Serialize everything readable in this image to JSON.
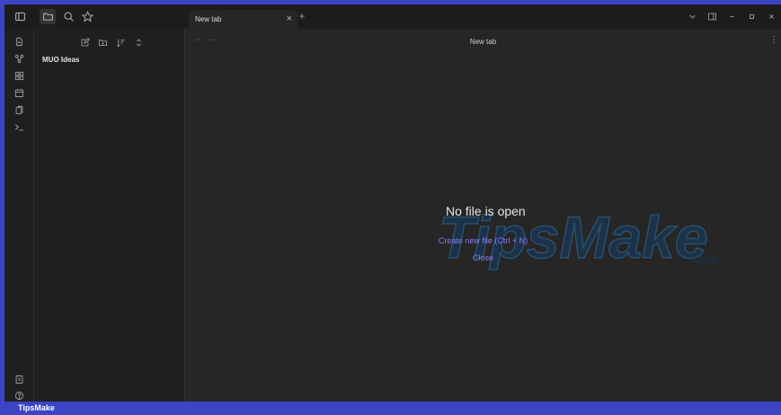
{
  "titlebar": {
    "icons": [
      "sidebar-toggle-icon",
      "folder-icon",
      "search-icon",
      "star-icon"
    ],
    "tab": {
      "title": "New tab",
      "close": "×"
    },
    "new_tab": "+",
    "window_controls": [
      "chevron-down-icon",
      "layout-icon",
      "minimize-icon",
      "maximize-icon",
      "close-icon"
    ]
  },
  "ribbon": {
    "top": [
      "open-quick-switcher-icon",
      "graph-view-icon",
      "canvas-icon",
      "daily-note-icon",
      "templates-icon",
      "command-palette-icon"
    ],
    "bottom": [
      "vault-switcher-icon",
      "help-icon"
    ]
  },
  "explorer": {
    "tools": [
      "new-note-icon",
      "new-folder-icon",
      "sort-icon",
      "collapse-icon"
    ],
    "vault_name": "MUO Ideas"
  },
  "main": {
    "back": "←",
    "forward": "→",
    "view_title": "New tab",
    "more": "⋮",
    "empty_title": "No file is open",
    "create_link": "Create new file (Ctrl + N)",
    "close_link": "Close"
  },
  "watermark": {
    "text": "TipsMake",
    "suffix": ".com"
  },
  "footer": {
    "label": "TipsMake"
  },
  "colors": {
    "accent": "#8a7cf4",
    "frame": "#3b44c4",
    "background": "#262626",
    "sidebar": "#1f1f1f"
  }
}
